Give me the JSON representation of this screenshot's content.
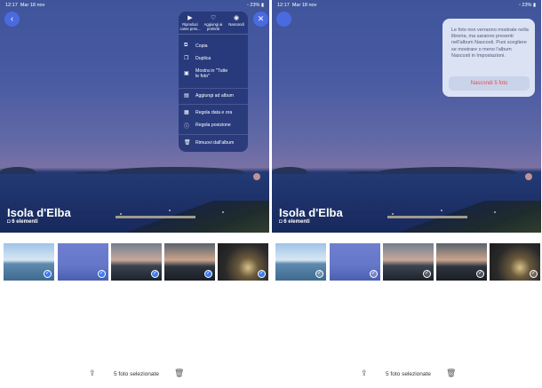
{
  "status_bar": {
    "time": "12:17",
    "date": "Mar 18 nov",
    "battery": "23%"
  },
  "album": {
    "title": "Isola d'Elba",
    "count": "6 elementi"
  },
  "menu": {
    "top_actions": [
      {
        "label": "Riproduci come pres...",
        "icon": "play-icon"
      },
      {
        "label": "Aggiungi ai preferiti",
        "icon": "heart-icon"
      },
      {
        "label": "Nascondi",
        "icon": "eye-icon"
      }
    ],
    "items": [
      {
        "label": "Copia",
        "icon": "copy-icon"
      },
      {
        "label": "Duplica",
        "icon": "duplicate-icon"
      },
      {
        "label": "Mostra in \"Tutte",
        "label2": "le foto\"",
        "icon": "photo-icon"
      },
      {
        "label": "Aggiungi ad album",
        "icon": "album-icon"
      },
      {
        "label": "Regola data e ora",
        "icon": "calendar-icon"
      },
      {
        "label": "Regola posizione",
        "icon": "info-icon"
      },
      {
        "label": "Rimuovi dall'album",
        "icon": "trash-icon"
      }
    ]
  },
  "popup": {
    "message": "Le foto non verranno mostrate nella libreria, ma saranno presenti nell'album Nascosti. Puoi scegliere se mostrare o meno l'album Nascosti in Impostazioni.",
    "button": "Nascondi 5 foto"
  },
  "toolbar": {
    "selection_text": "5 foto selezionate"
  },
  "colors": {
    "accent": "#3b7bf0",
    "destructive": "#e44d4d"
  }
}
